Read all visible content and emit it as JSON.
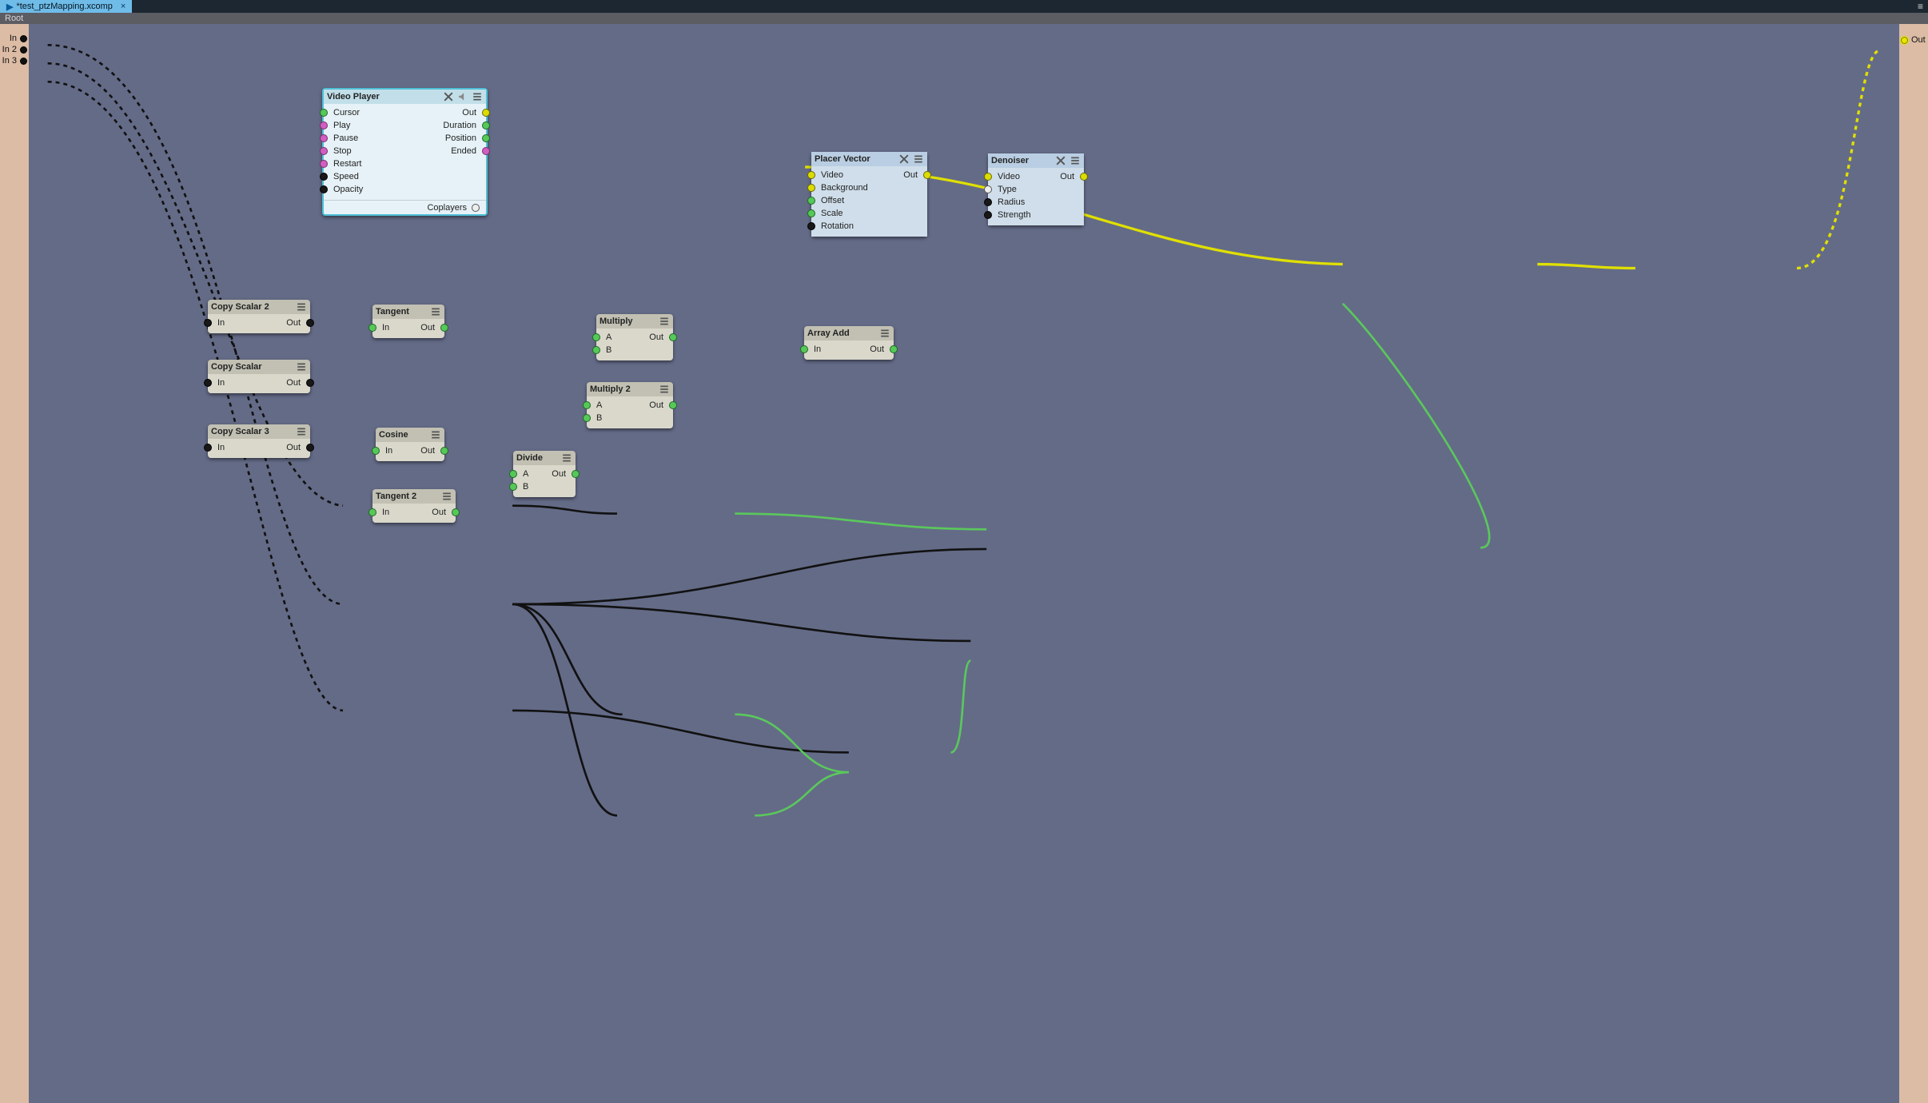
{
  "tab": {
    "title": "*test_ptzMapping.xcomp"
  },
  "root_label": "Root",
  "rail": {
    "left": [
      "In",
      "In 2",
      "In 3"
    ],
    "right": [
      "Out"
    ]
  },
  "nodes": {
    "video_player": {
      "title": "Video Player",
      "inputs": [
        "Cursor",
        "Play",
        "Pause",
        "Stop",
        "Restart",
        "Speed",
        "Opacity"
      ],
      "outputs": [
        "Out",
        "Duration",
        "Position",
        "Ended"
      ],
      "footer": "Coplayers"
    },
    "placer_vector": {
      "title": "Placer Vector",
      "inputs": [
        "Video",
        "Background",
        "Offset",
        "Scale",
        "Rotation"
      ],
      "outputs": [
        "Out"
      ]
    },
    "denoiser": {
      "title": "Denoiser",
      "inputs": [
        "Video",
        "Type",
        "Radius",
        "Strength"
      ],
      "outputs": [
        "Out"
      ]
    },
    "copy_scalar_2": {
      "title": "Copy Scalar 2",
      "in": "In",
      "out": "Out"
    },
    "copy_scalar": {
      "title": "Copy Scalar",
      "in": "In",
      "out": "Out"
    },
    "copy_scalar_3": {
      "title": "Copy Scalar 3",
      "in": "In",
      "out": "Out"
    },
    "tangent": {
      "title": "Tangent",
      "in": "In",
      "out": "Out"
    },
    "tangent_2": {
      "title": "Tangent 2",
      "in": "In",
      "out": "Out"
    },
    "cosine": {
      "title": "Cosine",
      "in": "In",
      "out": "Out"
    },
    "multiply": {
      "title": "Multiply",
      "a": "A",
      "b": "B",
      "out": "Out"
    },
    "multiply_2": {
      "title": "Multiply 2",
      "a": "A",
      "b": "B",
      "out": "Out"
    },
    "divide": {
      "title": "Divide",
      "a": "A",
      "b": "B",
      "out": "Out"
    },
    "array_add": {
      "title": "Array Add",
      "in": "In",
      "out": "Out"
    }
  },
  "colors": {
    "accent_selected": "#4fbfd6",
    "wire_yellow": "#e0e000",
    "wire_green": "#5ac85c",
    "wire_black": "#111",
    "wire_dash": "#222"
  }
}
